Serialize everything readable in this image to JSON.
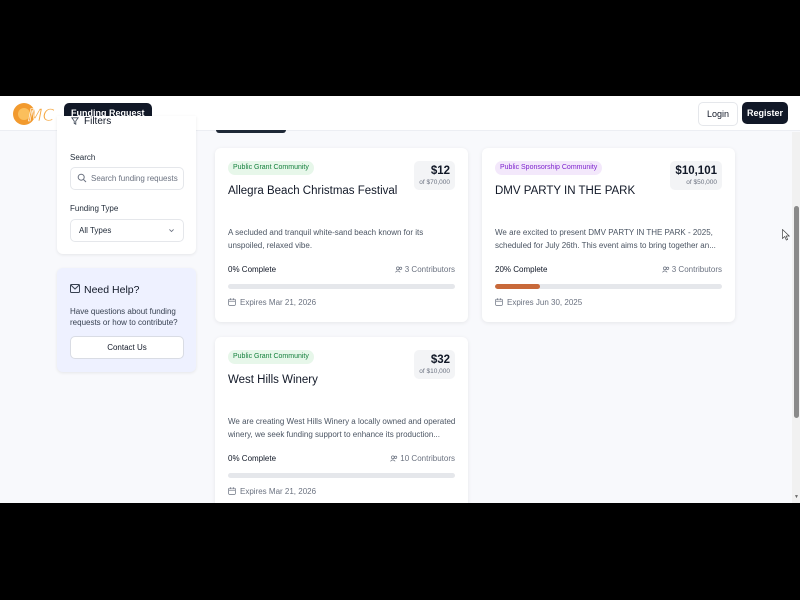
{
  "header": {
    "brand_button": "Funding Request",
    "login": "Login",
    "register": "Register",
    "colors": {
      "dark": "#111827",
      "logo_orange": "#f29a2e",
      "progress": "#c8693a"
    }
  },
  "sidebar": {
    "filters_title": "Filters",
    "search_label": "Search",
    "search_placeholder": "Search funding requests",
    "type_label": "Funding Type",
    "type_value": "All Types"
  },
  "help": {
    "title": "Need Help?",
    "text": "Have questions about funding requests or how to contribute?",
    "button": "Contact Us"
  },
  "cards": [
    {
      "badge": "Public Grant Community",
      "title": "Allegra Beach Christmas Festival",
      "amount": "$12",
      "goal": "of $70,000",
      "description": "A secluded and tranquil white-sand beach known for its unspoiled, relaxed vibe.",
      "complete": "0% Complete",
      "progress": 0,
      "contributors": "3 Contributors",
      "expires": "Expires Mar 21, 2026"
    },
    {
      "badge": "Public Sponsorship Community",
      "title": "DMV PARTY IN THE PARK",
      "amount": "$10,101",
      "goal": "of $50,000",
      "description": "We are excited to present DMV PARTY IN THE PARK - 2025, scheduled for July 26th. This event aims to bring together an...",
      "complete": "20% Complete",
      "progress": 20,
      "contributors": "3 Contributors",
      "expires": "Expires Jun 30, 2025"
    },
    {
      "badge": "Public Grant Community",
      "title": "West Hills Winery",
      "amount": "$32",
      "goal": "of $10,000",
      "description": "We are creating West Hills Winery a locally owned and operated winery, we seek funding support to enhance its production...",
      "complete": "0% Complete",
      "progress": 0,
      "contributors": "10 Contributors",
      "expires": "Expires Mar 21, 2026"
    }
  ]
}
